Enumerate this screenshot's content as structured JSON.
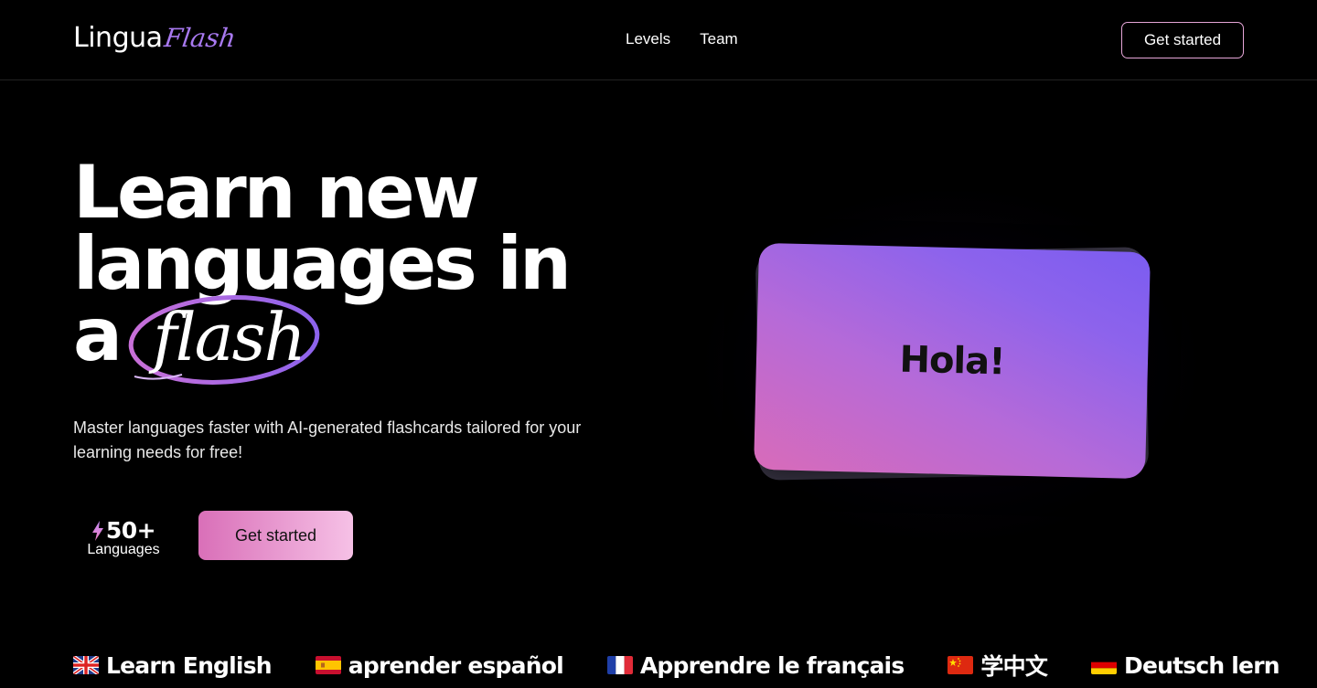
{
  "header": {
    "logo_main": "Lingua",
    "logo_accent": "Flash",
    "nav": [
      {
        "label": "Levels"
      },
      {
        "label": "Team"
      }
    ],
    "cta_label": "Get started"
  },
  "hero": {
    "title_line1": "Learn new",
    "title_line2": "languages in",
    "title_line3_prefix": "a",
    "title_highlight": "flash",
    "subtitle": "Master languages faster with AI-generated flashcards tailored for your learning needs for free!",
    "stat_value": "50+",
    "stat_label": "Languages",
    "cta_label": "Get started"
  },
  "flashcard": {
    "word": "Hola!"
  },
  "marquee": [
    {
      "flag": "uk-flag-icon",
      "text": "Learn English"
    },
    {
      "flag": "spain-flag-icon",
      "text": "aprender español"
    },
    {
      "flag": "france-flag-icon",
      "text": "Apprendre le français"
    },
    {
      "flag": "china-flag-icon",
      "text": "学中文"
    },
    {
      "flag": "germany-flag-icon",
      "text": "Deutsch lern"
    }
  ],
  "colors": {
    "background": "#000000",
    "accent_purple": "#a879f0",
    "cta_gradient_start": "#d96fb8",
    "cta_gradient_end": "#f6c1e6",
    "card_gradient_start": "#d86bb9",
    "card_gradient_end": "#7b5cf0"
  }
}
